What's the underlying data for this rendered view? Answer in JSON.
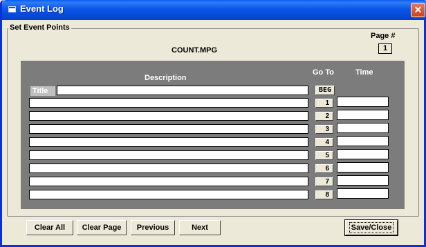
{
  "window": {
    "title": "Event Log",
    "close_glyph": "✕"
  },
  "group": {
    "legend": "Set Event Points"
  },
  "page": {
    "label": "Page #",
    "number": "1"
  },
  "filename": "COUNT.MPG",
  "table": {
    "col_description": "Description",
    "col_goto": "Go To",
    "col_time": "Time",
    "title_label": "Title",
    "beg_label": "BEG",
    "rows": [
      "1",
      "2",
      "3",
      "4",
      "5",
      "6",
      "7",
      "8"
    ]
  },
  "buttons": {
    "clear_all": "Clear All",
    "clear_page": "Clear Page",
    "previous": "Previous",
    "next": "Next",
    "save_close": "Save/Close"
  }
}
